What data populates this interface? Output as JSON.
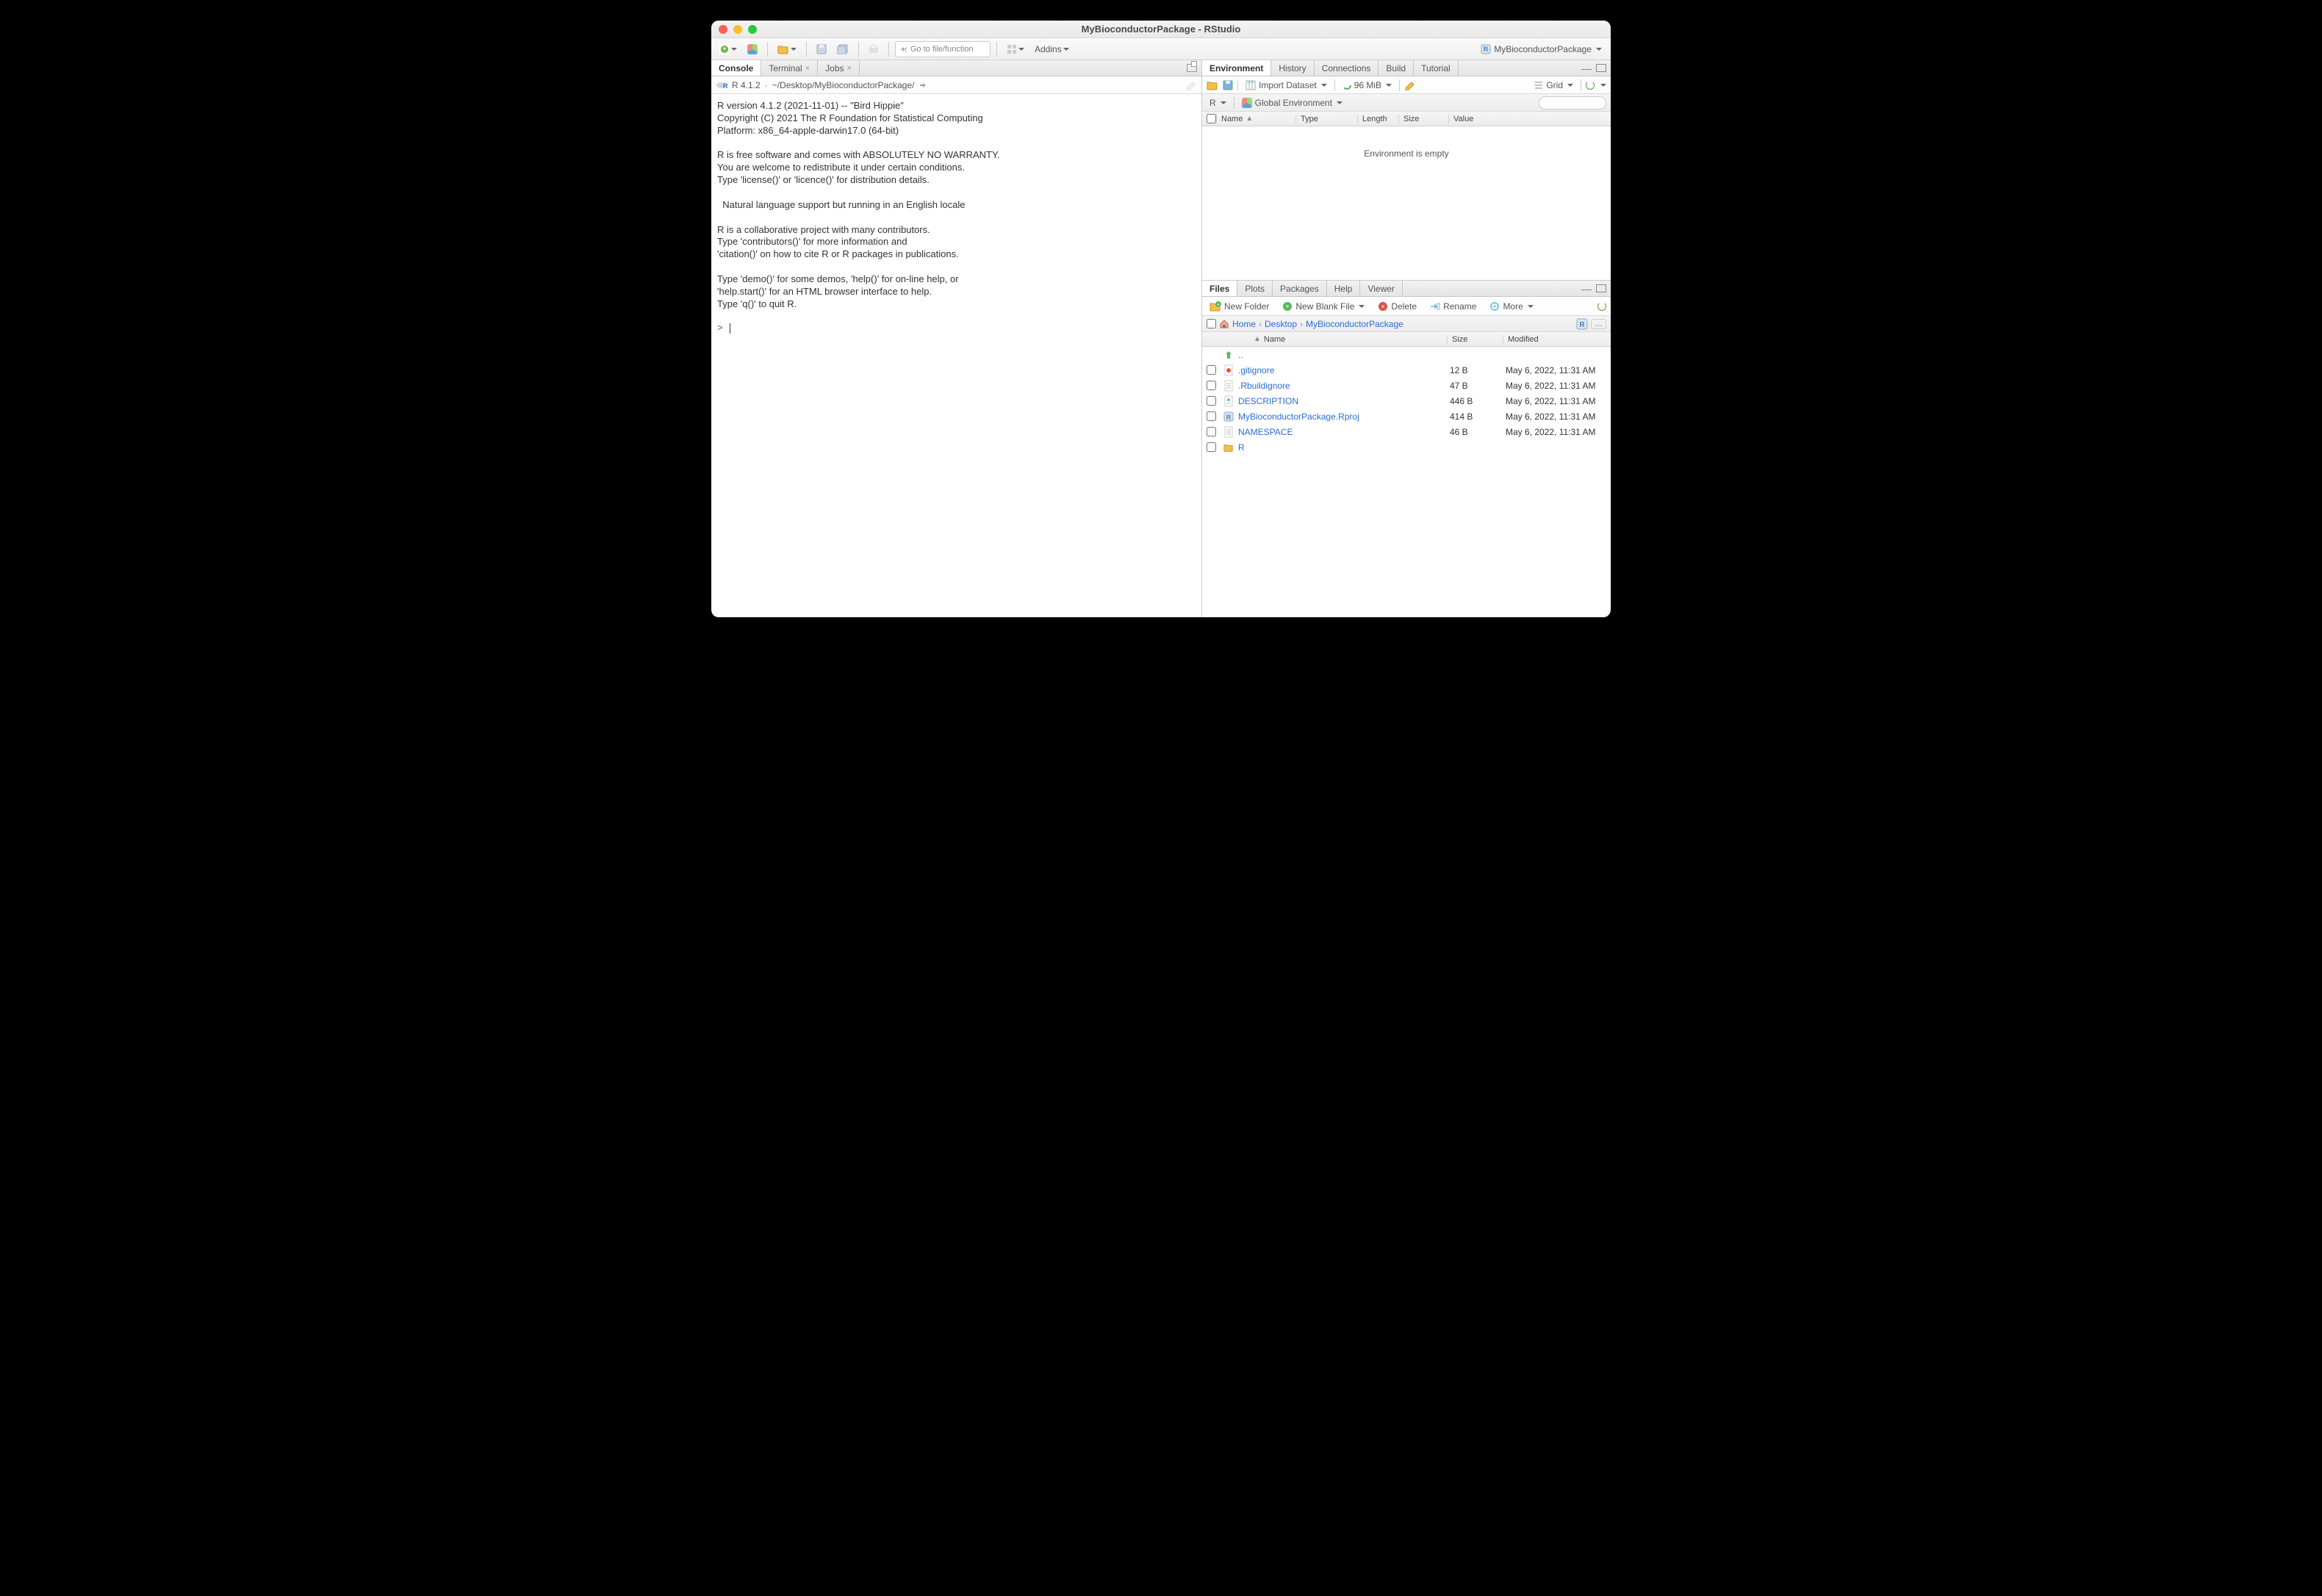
{
  "titlebar": {
    "title": "MyBioconductorPackage - RStudio"
  },
  "toolbar": {
    "goto_placeholder": "Go to file/function",
    "addins": "Addins",
    "project": "MyBioconductorPackage"
  },
  "left": {
    "tabs": {
      "console": "Console",
      "terminal": "Terminal",
      "jobs": "Jobs"
    },
    "subbar": {
      "r_version": "R 4.1.2",
      "sep": "·",
      "path": "~/Desktop/MyBioconductorPackage/"
    },
    "console_text": "R version 4.1.2 (2021-11-01) -- \"Bird Hippie\"\nCopyright (C) 2021 The R Foundation for Statistical Computing\nPlatform: x86_64-apple-darwin17.0 (64-bit)\n\nR is free software and comes with ABSOLUTELY NO WARRANTY.\nYou are welcome to redistribute it under certain conditions.\nType 'license()' or 'licence()' for distribution details.\n\n  Natural language support but running in an English locale\n\nR is a collaborative project with many contributors.\nType 'contributors()' for more information and\n'citation()' on how to cite R or R packages in publications.\n\nType 'demo()' for some demos, 'help()' for on-line help, or\n'help.start()' for an HTML browser interface to help.\nType 'q()' to quit R.\n",
    "prompt": ">"
  },
  "env": {
    "tabs": {
      "environment": "Environment",
      "history": "History",
      "connections": "Connections",
      "build": "Build",
      "tutorial": "Tutorial"
    },
    "bar": {
      "import": "Import Dataset",
      "mem": "96 MiB",
      "grid": "Grid"
    },
    "sub": {
      "r": "R",
      "global": "Global Environment"
    },
    "cols": {
      "name": "Name",
      "type": "Type",
      "length": "Length",
      "size": "Size",
      "value": "Value"
    },
    "empty": "Environment is empty"
  },
  "files": {
    "tabs": {
      "files": "Files",
      "plots": "Plots",
      "packages": "Packages",
      "help": "Help",
      "viewer": "Viewer"
    },
    "bar": {
      "new_folder": "New Folder",
      "new_blank": "New Blank File",
      "delete": "Delete",
      "rename": "Rename",
      "more": "More"
    },
    "crumbs": {
      "home": "Home",
      "desktop": "Desktop",
      "pkg": "MyBioconductorPackage",
      "dots": "…"
    },
    "cols": {
      "name": "Name",
      "size": "Size",
      "modified": "Modified"
    },
    "up": "..",
    "rows": [
      {
        "icon": "git",
        "name": ".gitignore",
        "size": "12 B",
        "mod": "May 6, 2022, 11:31 AM"
      },
      {
        "icon": "txt",
        "name": ".Rbuildignore",
        "size": "47 B",
        "mod": "May 6, 2022, 11:31 AM"
      },
      {
        "icon": "desc",
        "name": "DESCRIPTION",
        "size": "446 B",
        "mod": "May 6, 2022, 11:31 AM"
      },
      {
        "icon": "rproj",
        "name": "MyBioconductorPackage.Rproj",
        "size": "414 B",
        "mod": "May 6, 2022, 11:31 AM"
      },
      {
        "icon": "txt",
        "name": "NAMESPACE",
        "size": "46 B",
        "mod": "May 6, 2022, 11:31 AM"
      },
      {
        "icon": "folder",
        "name": "R",
        "size": "",
        "mod": ""
      }
    ]
  }
}
